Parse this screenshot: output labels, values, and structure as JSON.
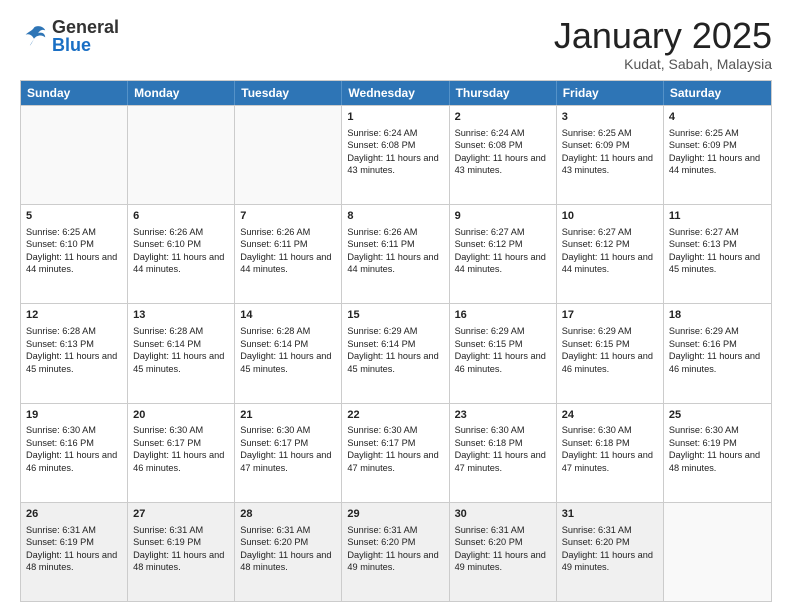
{
  "logo": {
    "general": "General",
    "blue": "Blue"
  },
  "header": {
    "month": "January 2025",
    "location": "Kudat, Sabah, Malaysia"
  },
  "days": [
    "Sunday",
    "Monday",
    "Tuesday",
    "Wednesday",
    "Thursday",
    "Friday",
    "Saturday"
  ],
  "weeks": [
    [
      {
        "day": "",
        "empty": true
      },
      {
        "day": "",
        "empty": true
      },
      {
        "day": "",
        "empty": true
      },
      {
        "day": "1",
        "sunrise": "6:24 AM",
        "sunset": "6:08 PM",
        "daylight": "11 hours and 43 minutes."
      },
      {
        "day": "2",
        "sunrise": "6:24 AM",
        "sunset": "6:08 PM",
        "daylight": "11 hours and 43 minutes."
      },
      {
        "day": "3",
        "sunrise": "6:25 AM",
        "sunset": "6:09 PM",
        "daylight": "11 hours and 43 minutes."
      },
      {
        "day": "4",
        "sunrise": "6:25 AM",
        "sunset": "6:09 PM",
        "daylight": "11 hours and 44 minutes."
      }
    ],
    [
      {
        "day": "5",
        "sunrise": "6:25 AM",
        "sunset": "6:10 PM",
        "daylight": "11 hours and 44 minutes."
      },
      {
        "day": "6",
        "sunrise": "6:26 AM",
        "sunset": "6:10 PM",
        "daylight": "11 hours and 44 minutes."
      },
      {
        "day": "7",
        "sunrise": "6:26 AM",
        "sunset": "6:11 PM",
        "daylight": "11 hours and 44 minutes."
      },
      {
        "day": "8",
        "sunrise": "6:26 AM",
        "sunset": "6:11 PM",
        "daylight": "11 hours and 44 minutes."
      },
      {
        "day": "9",
        "sunrise": "6:27 AM",
        "sunset": "6:12 PM",
        "daylight": "11 hours and 44 minutes."
      },
      {
        "day": "10",
        "sunrise": "6:27 AM",
        "sunset": "6:12 PM",
        "daylight": "11 hours and 44 minutes."
      },
      {
        "day": "11",
        "sunrise": "6:27 AM",
        "sunset": "6:13 PM",
        "daylight": "11 hours and 45 minutes."
      }
    ],
    [
      {
        "day": "12",
        "sunrise": "6:28 AM",
        "sunset": "6:13 PM",
        "daylight": "11 hours and 45 minutes."
      },
      {
        "day": "13",
        "sunrise": "6:28 AM",
        "sunset": "6:14 PM",
        "daylight": "11 hours and 45 minutes."
      },
      {
        "day": "14",
        "sunrise": "6:28 AM",
        "sunset": "6:14 PM",
        "daylight": "11 hours and 45 minutes."
      },
      {
        "day": "15",
        "sunrise": "6:29 AM",
        "sunset": "6:14 PM",
        "daylight": "11 hours and 45 minutes."
      },
      {
        "day": "16",
        "sunrise": "6:29 AM",
        "sunset": "6:15 PM",
        "daylight": "11 hours and 46 minutes."
      },
      {
        "day": "17",
        "sunrise": "6:29 AM",
        "sunset": "6:15 PM",
        "daylight": "11 hours and 46 minutes."
      },
      {
        "day": "18",
        "sunrise": "6:29 AM",
        "sunset": "6:16 PM",
        "daylight": "11 hours and 46 minutes."
      }
    ],
    [
      {
        "day": "19",
        "sunrise": "6:30 AM",
        "sunset": "6:16 PM",
        "daylight": "11 hours and 46 minutes."
      },
      {
        "day": "20",
        "sunrise": "6:30 AM",
        "sunset": "6:17 PM",
        "daylight": "11 hours and 46 minutes."
      },
      {
        "day": "21",
        "sunrise": "6:30 AM",
        "sunset": "6:17 PM",
        "daylight": "11 hours and 47 minutes."
      },
      {
        "day": "22",
        "sunrise": "6:30 AM",
        "sunset": "6:17 PM",
        "daylight": "11 hours and 47 minutes."
      },
      {
        "day": "23",
        "sunrise": "6:30 AM",
        "sunset": "6:18 PM",
        "daylight": "11 hours and 47 minutes."
      },
      {
        "day": "24",
        "sunrise": "6:30 AM",
        "sunset": "6:18 PM",
        "daylight": "11 hours and 47 minutes."
      },
      {
        "day": "25",
        "sunrise": "6:30 AM",
        "sunset": "6:19 PM",
        "daylight": "11 hours and 48 minutes."
      }
    ],
    [
      {
        "day": "26",
        "sunrise": "6:31 AM",
        "sunset": "6:19 PM",
        "daylight": "11 hours and 48 minutes."
      },
      {
        "day": "27",
        "sunrise": "6:31 AM",
        "sunset": "6:19 PM",
        "daylight": "11 hours and 48 minutes."
      },
      {
        "day": "28",
        "sunrise": "6:31 AM",
        "sunset": "6:20 PM",
        "daylight": "11 hours and 48 minutes."
      },
      {
        "day": "29",
        "sunrise": "6:31 AM",
        "sunset": "6:20 PM",
        "daylight": "11 hours and 49 minutes."
      },
      {
        "day": "30",
        "sunrise": "6:31 AM",
        "sunset": "6:20 PM",
        "daylight": "11 hours and 49 minutes."
      },
      {
        "day": "31",
        "sunrise": "6:31 AM",
        "sunset": "6:20 PM",
        "daylight": "11 hours and 49 minutes."
      },
      {
        "day": "",
        "empty": true
      }
    ]
  ],
  "labels": {
    "sunrise": "Sunrise:",
    "sunset": "Sunset:",
    "daylight": "Daylight:"
  }
}
